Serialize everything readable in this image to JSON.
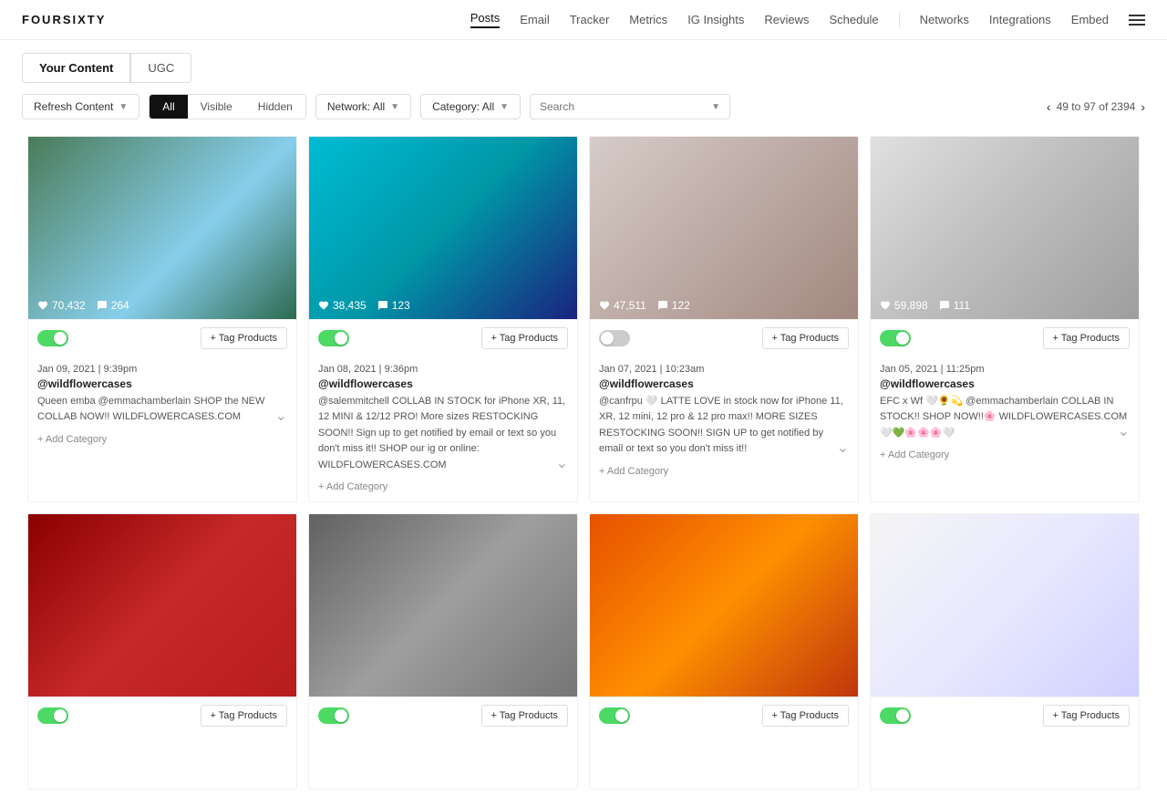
{
  "logo": "FOURSIXTY",
  "nav": {
    "items": [
      {
        "label": "Posts",
        "active": true
      },
      {
        "label": "Email",
        "active": false
      },
      {
        "label": "Tracker",
        "active": false
      },
      {
        "label": "Metrics",
        "active": false
      },
      {
        "label": "IG Insights",
        "active": false
      },
      {
        "label": "Reviews",
        "active": false
      },
      {
        "label": "Schedule",
        "active": false
      },
      {
        "label": "Networks",
        "active": false
      },
      {
        "label": "Integrations",
        "active": false
      },
      {
        "label": "Embed",
        "active": false
      }
    ]
  },
  "tabs": [
    {
      "label": "Your Content",
      "active": true
    },
    {
      "label": "UGC",
      "active": false
    }
  ],
  "filters": {
    "refresh_label": "Refresh Content",
    "visibility": {
      "options": [
        "All",
        "Visible",
        "Hidden"
      ],
      "active": "All"
    },
    "network_label": "Network: All",
    "category_label": "Category: All",
    "search_placeholder": "Search"
  },
  "pagination": {
    "text": "49 to 97 of 2394",
    "prev": "‹",
    "next": "›"
  },
  "posts": [
    {
      "id": 1,
      "date": "Jan 09, 2021 | 9:39pm",
      "handle": "@wildflowercases",
      "caption": "Queen emba @emmachamberlain SHOP the NEW COLLAB NOW!! WILDFLOWERCASES.COM",
      "likes": "70,432",
      "comments": "264",
      "visible": true,
      "bg": "img-bg-1"
    },
    {
      "id": 2,
      "date": "Jan 08, 2021 | 9:36pm",
      "handle": "@wildflowercases",
      "caption": "@salemmitchell COLLAB IN STOCK for iPhone XR, 11, 12 MINI & 12/12 PRO! More sizes RESTOCKING SOON!! Sign up to get notified by email or text so you don't miss it!! SHOP our ig or online: WILDFLOWERCASES.COM",
      "likes": "38,435",
      "comments": "123",
      "visible": true,
      "bg": "img-bg-2"
    },
    {
      "id": 3,
      "date": "Jan 07, 2021 | 10:23am",
      "handle": "@wildflowercases",
      "caption": "@canfrpu 🤍 LATTE LOVE in stock now for iPhone 11, XR, 12 mini, 12 pro & 12 pro max!! MORE SIZES RESTOCKING SOON!! SIGN UP to get notified by email or text so you don't miss it!!",
      "likes": "47,511",
      "comments": "122",
      "visible": false,
      "bg": "img-bg-3"
    },
    {
      "id": 4,
      "date": "Jan 05, 2021 | 11:25pm",
      "handle": "@wildflowercases",
      "caption": "EFC x Wf 🤍🌻💫 @emmachamberlain COLLAB IN STOCK!! SHOP NOW!!🌸 WILDFLOWERCASES.COM 🤍💚🌸🌸🌸🤍",
      "likes": "59,898",
      "comments": "111",
      "visible": true,
      "bg": "img-bg-4"
    },
    {
      "id": 5,
      "date": "",
      "handle": "",
      "caption": "",
      "likes": "",
      "comments": "",
      "visible": true,
      "bg": "img-bg-5"
    },
    {
      "id": 6,
      "date": "",
      "handle": "",
      "caption": "",
      "likes": "",
      "comments": "",
      "visible": true,
      "bg": "img-bg-6"
    },
    {
      "id": 7,
      "date": "",
      "handle": "",
      "caption": "",
      "likes": "",
      "comments": "",
      "visible": true,
      "bg": "img-bg-7"
    },
    {
      "id": 8,
      "date": "",
      "handle": "",
      "caption": "",
      "likes": "",
      "comments": "",
      "visible": true,
      "bg": "img-bg-8"
    }
  ],
  "buttons": {
    "tag_products": "+ Tag Products",
    "add_category": "+ Add Category"
  }
}
